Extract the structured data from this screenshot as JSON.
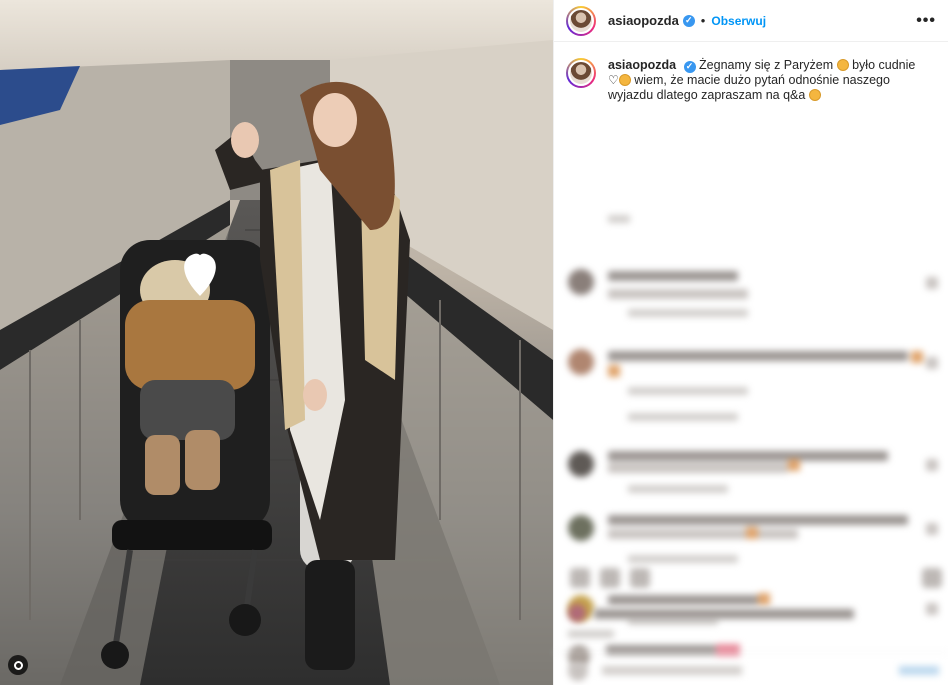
{
  "post": {
    "username": "asiaopozda",
    "verified_mark": "✓",
    "separator": "•",
    "follow_label": "Obserwuj",
    "more_label": "•••"
  },
  "caption": {
    "username": "asiaopozda",
    "part1": "Żegnamy się z Paryżem",
    "part2": "było cudnie",
    "heart": "♡",
    "part3": "wiem, że macie dużo pytań odnośnie naszego wyjazdu dlatego zapraszam na q&a"
  },
  "icons": {
    "verified": "verified-badge-icon",
    "more": "more-options-icon",
    "heart": "heart-icon",
    "emoji": "emoji-icon",
    "photo_user": "user-tag-icon"
  },
  "colors": {
    "link_blue": "#0095f6",
    "verified_blue": "#3897f0",
    "text": "#262626",
    "border": "#efefef"
  }
}
